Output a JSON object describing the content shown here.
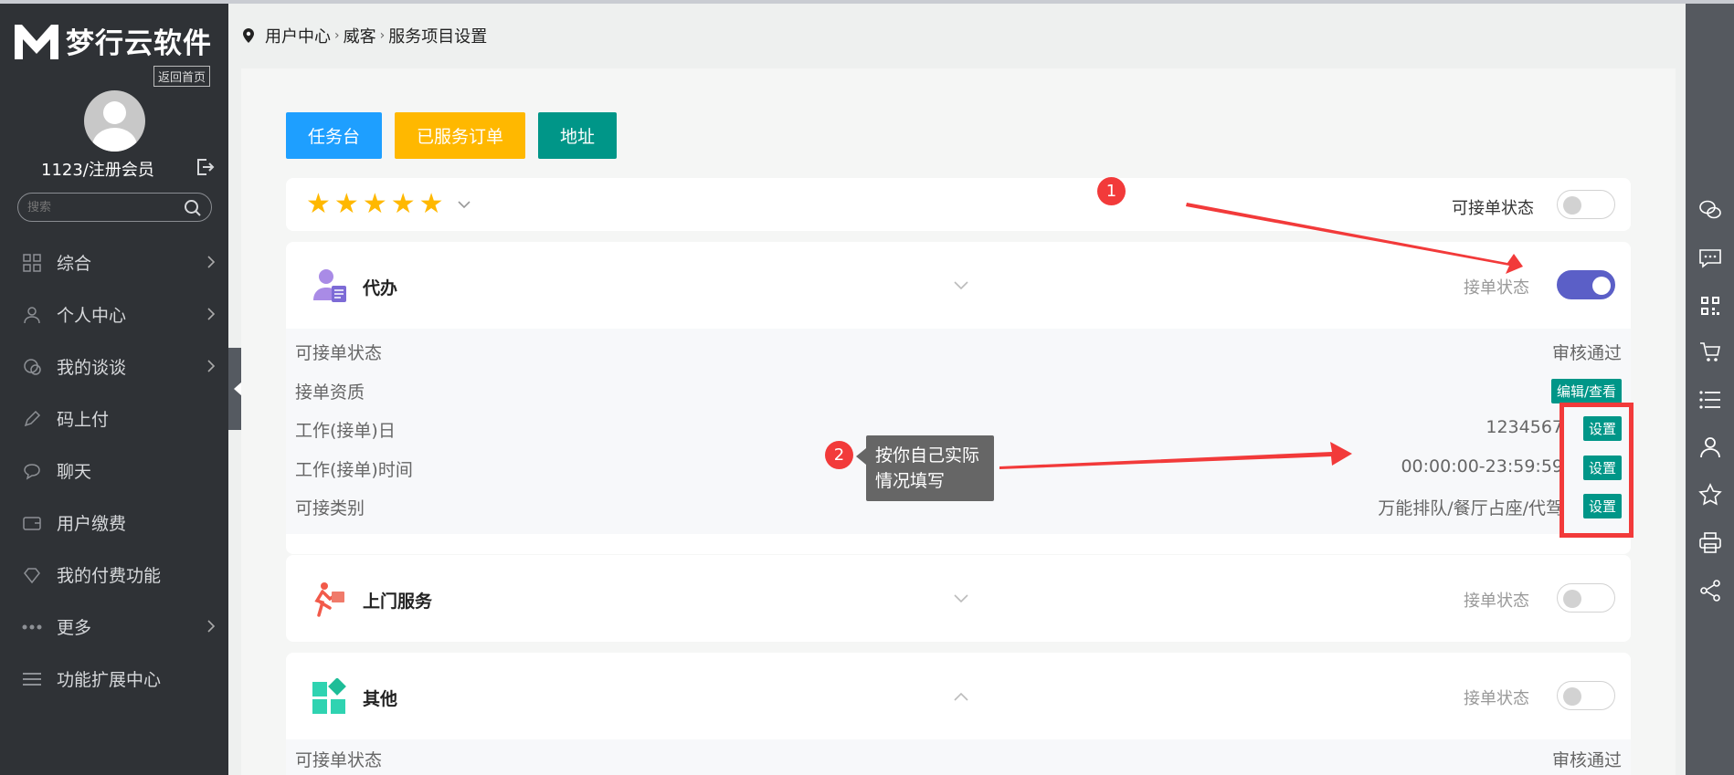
{
  "sidebar": {
    "logo_text": "梦行云软件",
    "home_link": "返回首页",
    "username": "1123/注册会员",
    "search_placeholder": "搜索",
    "items": [
      {
        "label": "综合",
        "icon": "grid-icon",
        "has_arrow": true
      },
      {
        "label": "个人中心",
        "icon": "user-icon",
        "has_arrow": true
      },
      {
        "label": "我的谈谈",
        "icon": "chat-bubbles-icon",
        "has_arrow": true
      },
      {
        "label": "码上付",
        "icon": "pencil-icon",
        "has_arrow": false
      },
      {
        "label": "聊天",
        "icon": "chat-icon",
        "has_arrow": false
      },
      {
        "label": "用户缴费",
        "icon": "wallet-icon",
        "has_arrow": false
      },
      {
        "label": "我的付费功能",
        "icon": "diamond-icon",
        "has_arrow": false
      },
      {
        "label": "更多",
        "icon": "more-dots-icon",
        "has_arrow": true
      },
      {
        "label": "功能扩展中心",
        "icon": "menu-lines-icon",
        "has_arrow": false
      }
    ]
  },
  "breadcrumb": {
    "items": [
      "用户中心",
      "威客",
      "服务项目设置"
    ]
  },
  "buttons": {
    "task": "任务台",
    "served_orders": "已服务订单",
    "address": "地址"
  },
  "rating": {
    "stars": 5,
    "available_label": "可接单状态",
    "available_on": false
  },
  "services": [
    {
      "title": "代办",
      "status_label": "接单状态",
      "status_on": true,
      "expanded": true,
      "rows": [
        {
          "key": "可接单状态",
          "value": "审核通过"
        },
        {
          "key": "接单资质",
          "value": "编辑/查看"
        },
        {
          "key": "工作(接单)日",
          "value": "1234567",
          "action": "设置"
        },
        {
          "key": "工作(接单)时间",
          "value": "00:00:00-23:59:59",
          "action": "设置"
        },
        {
          "key": "可接类别",
          "value": "万能排队/餐厅占座/代驾",
          "action": "设置"
        }
      ]
    },
    {
      "title": "上门服务",
      "status_label": "接单状态",
      "status_on": false
    },
    {
      "title": "其他",
      "status_label": "接单状态",
      "status_on": false,
      "rows": [
        {
          "key": "可接单状态",
          "value": "审核通过"
        }
      ]
    }
  ],
  "annotations": {
    "badge1": "1",
    "badge2": "2",
    "tip": "按你自己实际情况填写"
  },
  "colors": {
    "sidebar": "#2f3236",
    "blue": "#1e9fff",
    "yellow": "#ffb800",
    "green": "#009688",
    "toggle_on": "#5b5fc7",
    "annotation_red": "#f23a3a"
  },
  "right_toolbar": [
    "wechat-icon",
    "message-icon",
    "qrcode-icon",
    "cart-icon",
    "list-icon",
    "user-icon",
    "star-icon",
    "print-icon",
    "share-icon"
  ]
}
